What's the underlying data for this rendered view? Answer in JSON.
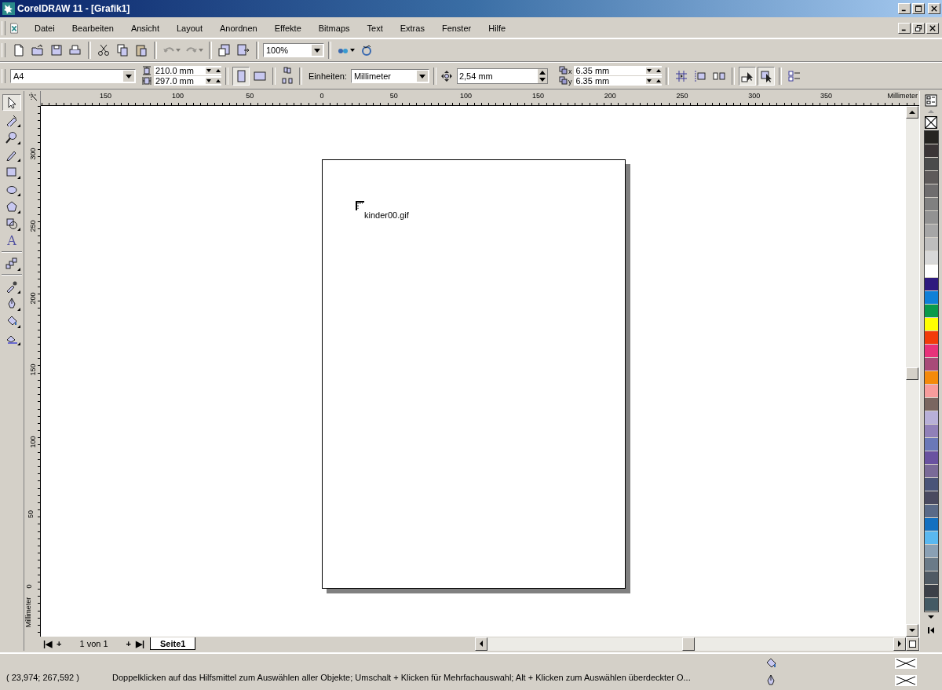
{
  "window": {
    "title": "CorelDRAW 11 - [Grafik1]"
  },
  "menu": [
    {
      "label": "Datei"
    },
    {
      "label": "Bearbeiten"
    },
    {
      "label": "Ansicht"
    },
    {
      "label": "Layout"
    },
    {
      "label": "Anordnen"
    },
    {
      "label": "Effekte"
    },
    {
      "label": "Bitmaps"
    },
    {
      "label": "Text"
    },
    {
      "label": "Extras"
    },
    {
      "label": "Fenster"
    },
    {
      "label": "Hilfe"
    }
  ],
  "toolbar": {
    "file_groups": [
      [
        {
          "kind": "new",
          "disabled": false
        },
        {
          "kind": "open",
          "disabled": false
        },
        {
          "kind": "save",
          "disabled": false
        },
        {
          "kind": "print",
          "disabled": false
        }
      ],
      [
        {
          "kind": "cut",
          "disabled": false
        },
        {
          "kind": "copy",
          "disabled": false
        },
        {
          "kind": "paste",
          "disabled": false
        }
      ],
      [
        {
          "kind": "undo",
          "disabled": true
        },
        {
          "kind": "redo",
          "disabled": true
        }
      ],
      [
        {
          "kind": "import",
          "disabled": false
        },
        {
          "kind": "export",
          "disabled": false
        }
      ]
    ],
    "zoom": "100%",
    "apps": [
      {
        "kind": "launcher",
        "disabled": false
      },
      {
        "kind": "online",
        "disabled": false
      }
    ]
  },
  "property_bar": {
    "paper_size": "A4",
    "width": "210.0 mm",
    "height": "297.0 mm",
    "orientation": [
      {
        "kind": "portrait",
        "selected": true
      },
      {
        "kind": "landscape",
        "selected": false
      }
    ],
    "units_label": "Einheiten:",
    "units": "Millimeter",
    "nudge": "2,54 mm",
    "duplicate_x_label": "x",
    "duplicate_x": "6.35 mm",
    "duplicate_y_label": "y",
    "duplicate_y": "6.35 mm",
    "toggles": [
      {
        "kind": "snap-grid",
        "selected": false
      },
      {
        "kind": "snap-guides",
        "selected": false
      },
      {
        "kind": "snap-objects",
        "selected": false
      },
      {
        "kind": "treat-filled",
        "selected": true
      },
      {
        "kind": "draw-outline",
        "selected": true
      }
    ]
  },
  "toolbox": [
    {
      "kind": "pick",
      "selected": true
    },
    {
      "kind": "shape",
      "selected": false
    },
    {
      "kind": "zoom",
      "selected": false
    },
    {
      "kind": "freehand",
      "selected": false
    },
    {
      "kind": "rectangle",
      "selected": false
    },
    {
      "kind": "ellipse",
      "selected": false
    },
    {
      "kind": "polygon",
      "selected": false
    },
    {
      "kind": "basic-shapes",
      "selected": false
    },
    {
      "kind": "text",
      "selected": false,
      "glyph": "A"
    },
    {
      "kind": "blend",
      "selected": false
    },
    {
      "kind": "eyedropper",
      "selected": false
    },
    {
      "kind": "outline",
      "selected": false
    },
    {
      "kind": "fill",
      "selected": false
    },
    {
      "kind": "interactive-fill",
      "selected": false
    }
  ],
  "rulers": {
    "horizontal": [
      "150",
      "100",
      "50",
      "0",
      "50",
      "100",
      "150",
      "200",
      "250",
      "300",
      "350"
    ],
    "horizontal_unit": "Millimeter",
    "vertical": [
      "300",
      "250",
      "200",
      "150",
      "100",
      "50",
      "0"
    ],
    "vertical_unit": "Millimeter"
  },
  "canvas": {
    "object_label": "kinder00.gif"
  },
  "page_nav": {
    "first": "|◀",
    "add_before": "+",
    "position": "1 von 1",
    "add_after": "+",
    "last": "▶|",
    "tabs": [
      {
        "label": "Seite1",
        "selected": true
      }
    ]
  },
  "palette": [
    {
      "color": "#262421"
    },
    {
      "color": "#3b3536"
    },
    {
      "color": "#4b4b4b"
    },
    {
      "color": "#5e5a5a"
    },
    {
      "color": "#6f6d6e"
    },
    {
      "color": "#808080"
    },
    {
      "color": "#929292"
    },
    {
      "color": "#a6a6a6"
    },
    {
      "color": "#bdbdbd"
    },
    {
      "color": "#d8d8d8"
    },
    {
      "color": "#ffffff"
    },
    {
      "color": "#2e1a7e"
    },
    {
      "color": "#0f80d8"
    },
    {
      "color": "#0a9a4a"
    },
    {
      "color": "#ffff00"
    },
    {
      "color": "#f23c0a"
    },
    {
      "color": "#e8327a"
    },
    {
      "color": "#a84a78"
    },
    {
      "color": "#f48a0a"
    },
    {
      "color": "#f79c9c"
    },
    {
      "color": "#7a6660"
    },
    {
      "color": "#b8b0d8"
    },
    {
      "color": "#9080b8"
    },
    {
      "color": "#6a78b8"
    },
    {
      "color": "#6a52a0"
    },
    {
      "color": "#7a6a98"
    },
    {
      "color": "#4a5478"
    },
    {
      "color": "#4a4a60"
    },
    {
      "color": "#5a6a88"
    },
    {
      "color": "#1470c0"
    },
    {
      "color": "#5ab8f0"
    },
    {
      "color": "#8aa0b4"
    },
    {
      "color": "#6a7a88"
    },
    {
      "color": "#505a64"
    },
    {
      "color": "#3c4048"
    },
    {
      "color": "#445a64"
    }
  ],
  "status_bar": {
    "coordinates": "( 23,974; 267,592 )",
    "message": "Doppelklicken auf das Hilfsmittel zum Auswählen aller Objekte; Umschalt + Klicken für Mehrfachauswahl; Alt + Klicken zum Auswählen überdeckter O..."
  }
}
